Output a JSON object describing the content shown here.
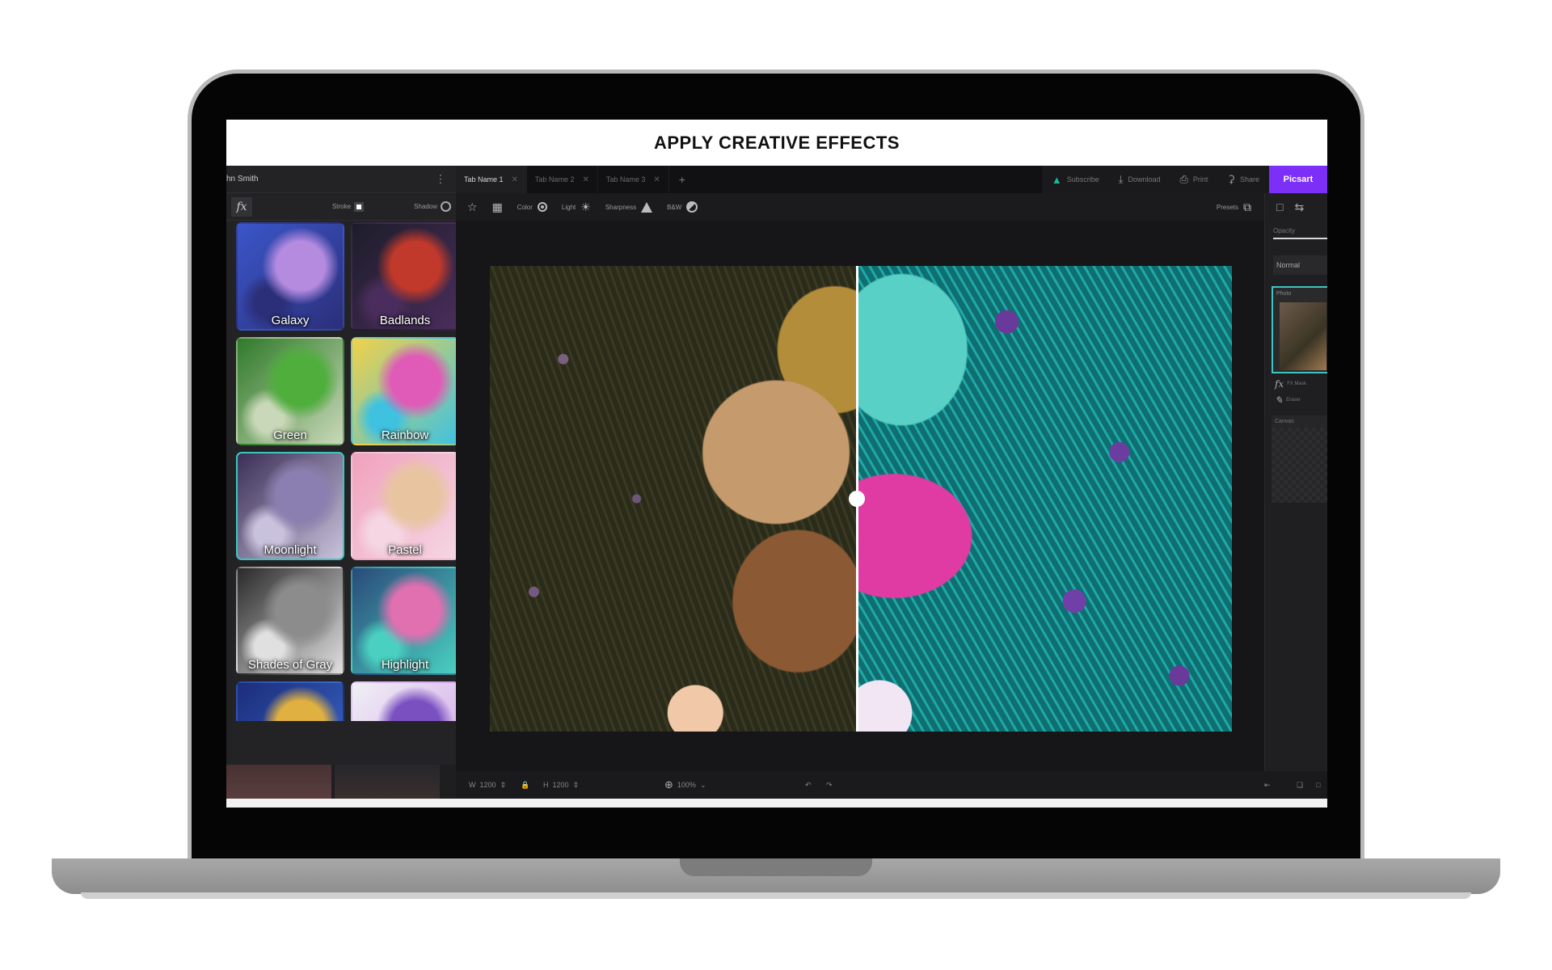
{
  "headline": "APPLY CREATIVE EFFECTS",
  "left_panel": {
    "user_name": "hn Smith",
    "more_icon": "more-vertical-icon",
    "fx_label": "fx",
    "stroke_label": "Stroke",
    "shadow_label": "Shadow",
    "effects": [
      {
        "label": "Galaxy",
        "colors": [
          "#3b56c9",
          "#b58be0",
          "#2b2f7a"
        ]
      },
      {
        "label": "Badlands",
        "colors": [
          "#1d1d2a",
          "#c1392b",
          "#4a2d5c"
        ]
      },
      {
        "label": "Green",
        "colors": [
          "#2f7a2a",
          "#4fae3c",
          "#c9d8b8"
        ]
      },
      {
        "label": "Rainbow",
        "colors": [
          "#f2d14a",
          "#e05ab7",
          "#3fc2e0"
        ]
      },
      {
        "label": "Moonlight",
        "colors": [
          "#3a2e55",
          "#8a7fb0",
          "#c9c2dc"
        ]
      },
      {
        "label": "Pastel",
        "colors": [
          "#f0a2bd",
          "#e8c5a0",
          "#f5d6e2"
        ]
      },
      {
        "label": "Shades of Gray",
        "colors": [
          "#2a2a2a",
          "#8c8c8c",
          "#e0e0e0"
        ]
      },
      {
        "label": "Highlight",
        "colors": [
          "#2a4a7a",
          "#e070b0",
          "#4ad0c0"
        ]
      },
      {
        "label": "",
        "colors": [
          "#1c2d7a",
          "#e0b040",
          "#3a6ad0"
        ]
      },
      {
        "label": "",
        "colors": [
          "#f0f0f5",
          "#7a50c0",
          "#d0a0e8"
        ]
      }
    ]
  },
  "tabs": [
    {
      "label": "Tab Name 1",
      "active": true
    },
    {
      "label": "Tab Name 2",
      "active": false
    },
    {
      "label": "Tab Name 3",
      "active": false
    }
  ],
  "top_actions": {
    "subscribe": "Subscribe",
    "download": "Download",
    "print": "Print",
    "share": "Share",
    "brand": "Picsart"
  },
  "toolbar": {
    "color": "Color",
    "light": "Light",
    "sharpness": "Sharpness",
    "bw": "B&W",
    "presets": "Presets"
  },
  "right_panel": {
    "opacity_label": "Opacity",
    "blend_mode": "Normal",
    "photo_layer": "Photo",
    "fx_mask": "FX Mask",
    "eraser": "Eraser",
    "canvas_layer": "Canvas"
  },
  "bottom_bar": {
    "width_label": "W",
    "width_value": "1200",
    "height_label": "H",
    "height_value": "1200",
    "zoom": "100%"
  },
  "colors": {
    "accent": "#7b2ff7",
    "selection": "#3ec5c0"
  }
}
